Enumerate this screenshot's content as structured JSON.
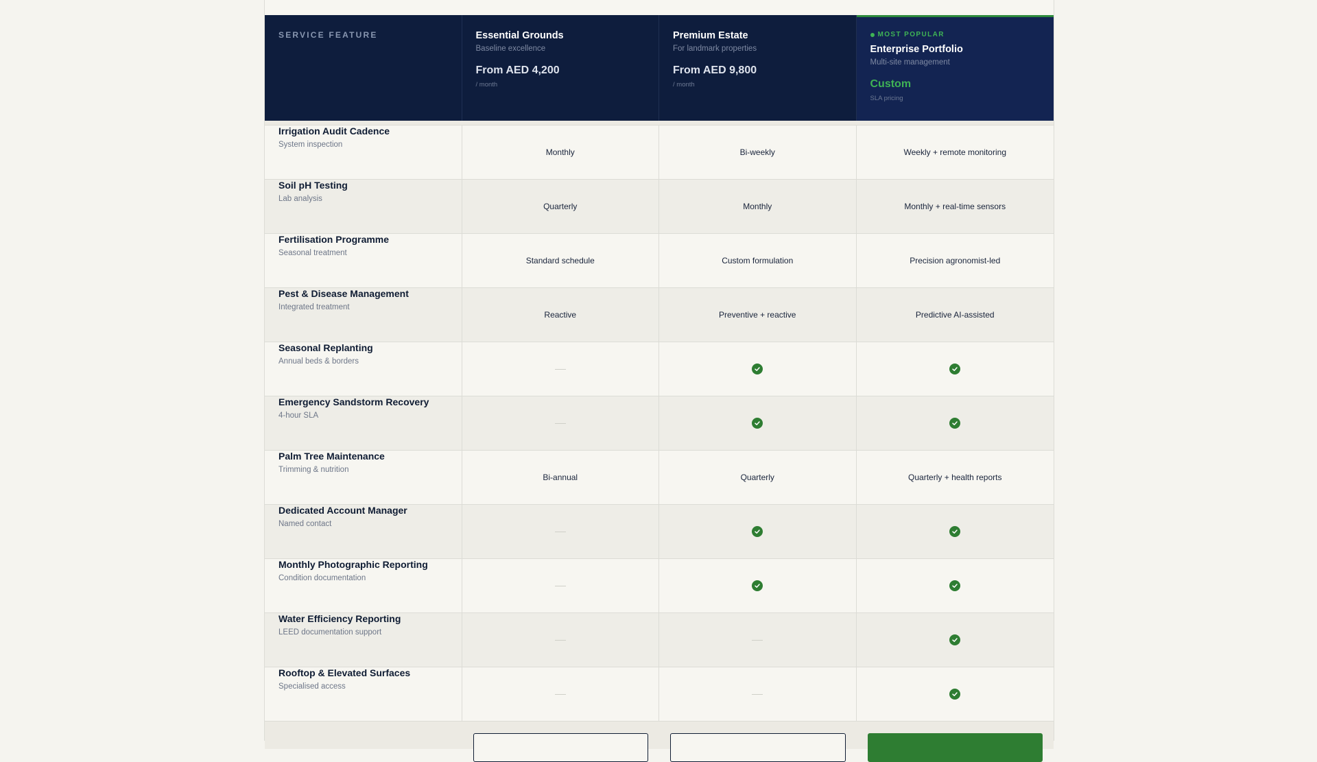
{
  "header": {
    "feature_label": "SERVICE FEATURE",
    "plans": [
      {
        "name": "Essential Grounds",
        "subtitle": "Baseline excellence",
        "price": "From AED 4,200",
        "period": "/ month"
      },
      {
        "name": "Premium Estate",
        "subtitle": "For landmark properties",
        "price": "From AED 9,800",
        "period": "/ month"
      },
      {
        "badge": "MOST POPULAR",
        "name": "Enterprise Portfolio",
        "subtitle": "Multi-site management",
        "price": "Custom",
        "period": "SLA pricing"
      }
    ]
  },
  "rows": [
    {
      "name": "Irrigation Audit Cadence",
      "sub": "System inspection",
      "values": [
        "Monthly",
        "Bi-weekly",
        "Weekly + remote monitoring"
      ]
    },
    {
      "name": "Soil pH Testing",
      "sub": "Lab analysis",
      "values": [
        "Quarterly",
        "Monthly",
        "Monthly + real-time sensors"
      ]
    },
    {
      "name": "Fertilisation Programme",
      "sub": "Seasonal treatment",
      "values": [
        "Standard schedule",
        "Custom formulation",
        "Precision agronomist-led"
      ]
    },
    {
      "name": "Pest & Disease Management",
      "sub": "Integrated treatment",
      "values": [
        "Reactive",
        "Preventive + reactive",
        "Predictive AI-assisted"
      ]
    },
    {
      "name": "Seasonal Replanting",
      "sub": "Annual beds & borders",
      "values": [
        "—",
        "✓",
        "✓"
      ]
    },
    {
      "name": "Emergency Sandstorm Recovery",
      "sub": "4-hour SLA",
      "values": [
        "—",
        "✓",
        "✓"
      ]
    },
    {
      "name": "Palm Tree Maintenance",
      "sub": "Trimming & nutrition",
      "values": [
        "Bi-annual",
        "Quarterly",
        "Quarterly + health reports"
      ]
    },
    {
      "name": "Dedicated Account Manager",
      "sub": "Named contact",
      "values": [
        "—",
        "✓",
        "✓"
      ]
    },
    {
      "name": "Monthly Photographic Reporting",
      "sub": "Condition documentation",
      "values": [
        "—",
        "✓",
        "✓"
      ]
    },
    {
      "name": "Water Efficiency Reporting",
      "sub": "LEED documentation support",
      "values": [
        "—",
        "—",
        "✓"
      ]
    },
    {
      "name": "Rooftop & Elevated Surfaces",
      "sub": "Specialised access",
      "values": [
        "—",
        "—",
        "✓"
      ]
    }
  ],
  "colors": {
    "navy": "#0e1d3d",
    "accent_green": "#3fb355",
    "check_green": "#2e7d32"
  }
}
